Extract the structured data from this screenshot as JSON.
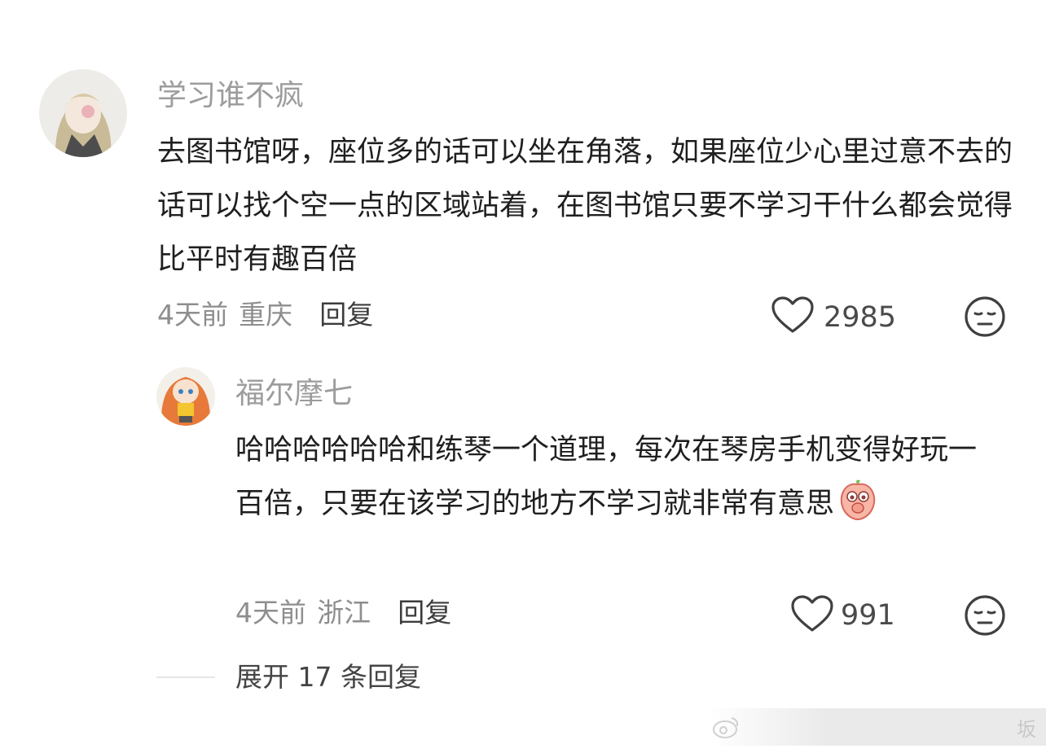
{
  "comments": [
    {
      "username": "学习谁不疯",
      "text": "去图书馆呀，座位多的话可以坐在角落，如果座位少心里过意不去的话可以找个空一点的区域站着，在图书馆只要不学习干什么都会觉得比平时有趣百倍",
      "time": "4天前",
      "location": "重庆",
      "reply_label": "回复",
      "likes": "2985"
    },
    {
      "username": "福尔摩七",
      "text": "哈哈哈哈哈哈和练琴一个道理，每次在琴房手机变得好玩一百倍，只要在该学习的地方不学习就非常有意思",
      "time": "4天前",
      "location": "浙江",
      "reply_label": "回复",
      "likes": "991",
      "emoji_icon": "peach-covering-mouth-emoji"
    }
  ],
  "expand_replies": "展开 17 条回复",
  "watermark": "坂"
}
